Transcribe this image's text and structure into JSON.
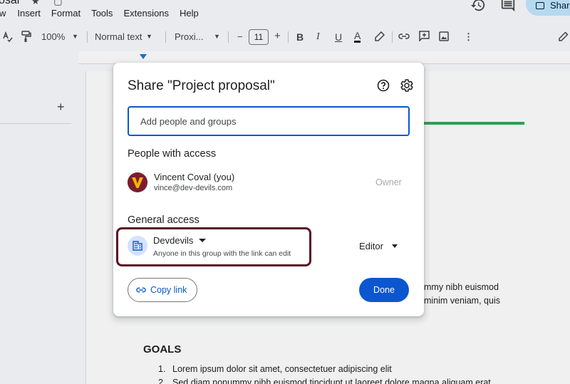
{
  "doc": {
    "title": "osal",
    "menus": [
      "w",
      "Insert",
      "Format",
      "Tools",
      "Extensions",
      "Help"
    ],
    "share_label": "Shar"
  },
  "toolbar": {
    "zoom": "100%",
    "style": "Normal text",
    "font": "Proxi...",
    "font_size": "11",
    "minus": "−",
    "plus": "+",
    "bold": "B",
    "italic": "I",
    "underline": "U",
    "text_color": "A"
  },
  "left_pane": {
    "add": "+"
  },
  "document_body": {
    "lines": [
      "mmy nibh euismod",
      "minim veniam, quis"
    ],
    "goals_heading": "GOALS",
    "list": [
      {
        "num": "1.",
        "text": "Lorem ipsum dolor sit amet, consectetuer adipiscing elit"
      },
      {
        "num": "2.",
        "text": "Sed diam nonummy nibh euismod tincidunt ut laoreet dolore magna aliquam erat"
      }
    ]
  },
  "dialog": {
    "title": "Share \"Project proposal\"",
    "add_placeholder": "Add people and groups",
    "people_heading": "People with access",
    "person": {
      "name": "Vincent Coval (you)",
      "email": "vince@dev-devils.com",
      "role": "Owner",
      "avatar_letter": "V"
    },
    "general_heading": "General access",
    "access": {
      "name": "Devdevils",
      "description": "Anyone in this group with the link can edit",
      "role": "Editor"
    },
    "copy_link": "Copy link",
    "done": "Done"
  },
  "colors": {
    "primary": "#0b57d0",
    "highlight_border": "#5b1225",
    "avatar_bg": "#7a1e2e",
    "avatar_letter": "#f5b400",
    "group_icon_bg": "#d3e3fd",
    "doc_rule": "#34a853"
  }
}
